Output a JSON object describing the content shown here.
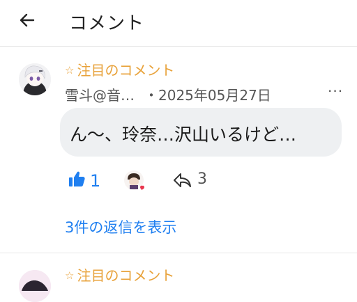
{
  "header": {
    "back_icon": "arrow-left-icon",
    "title": "コメント"
  },
  "comments": [
    {
      "featured_label": "注目のコメント",
      "author": "雪斗@音…",
      "date": "・2025年05月27日",
      "more": "···",
      "text": "ん～、玲奈…沢山いるけど…",
      "likes": "1",
      "replies_count": "3",
      "show_replies": "3件の返信を表示"
    },
    {
      "featured_label": "注目のコメント"
    }
  ],
  "colors": {
    "accent": "#1f7ff0",
    "featured": "#e8a23a",
    "bubble": "#eef0f2"
  }
}
